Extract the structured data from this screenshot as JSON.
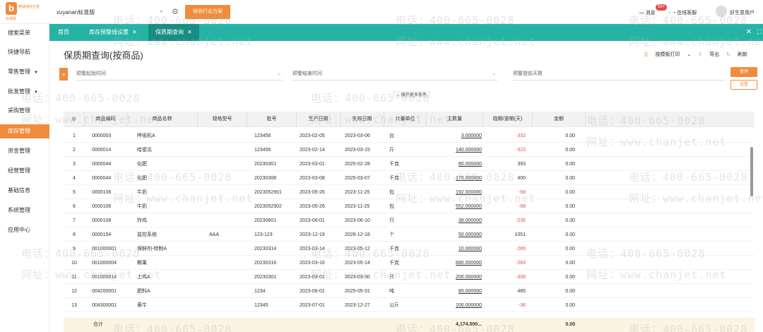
{
  "topbar": {
    "logo_char": "b",
    "logo_text": "畅捷通好生意",
    "logo_sub": "标准版",
    "company": "xuyanan标准版",
    "trial_button": "体验行业方案",
    "message_label": "消息",
    "message_badge": "99+",
    "online_label": "在线客服",
    "user_label": "好生意用户"
  },
  "sidebar": {
    "items": [
      {
        "label": "搜索菜单"
      },
      {
        "label": "快捷导航"
      },
      {
        "label": "零售管理"
      },
      {
        "label": "批发管理"
      },
      {
        "label": "采购管理"
      },
      {
        "label": "库存管理"
      },
      {
        "label": "资金管理"
      },
      {
        "label": "经营管理"
      },
      {
        "label": "基础信息"
      },
      {
        "label": "系统管理"
      },
      {
        "label": "应用中心"
      }
    ]
  },
  "tabs": {
    "home": "首页",
    "t1": "库存预警线设置",
    "t2": "保质期查询"
  },
  "page": {
    "title": "保质期查询(按商品)",
    "print": "按模板打印",
    "export": "导出",
    "refresh": "刷新",
    "f1": "预警起始时间",
    "f2": "预警结束时间",
    "f3": "预警提前天数",
    "query": "查询",
    "settings": "设置",
    "more": "展开更多条件"
  },
  "grid": {
    "headers": [
      "◎",
      "商品编码",
      "商品名称",
      "规格型号",
      "批号",
      "生产日期",
      "失效日期",
      "计量单位",
      "主数量",
      "临期/逾期(天)",
      "金额"
    ],
    "rows": [
      {
        "no": "1",
        "code": "0000003",
        "name": "呼吸机A",
        "spec": "",
        "batch": "123456",
        "prod": "2023-02-05",
        "exp": "2023-03-06",
        "unit": "台",
        "qty": "3.000000",
        "days": "-332",
        "amt": "0.00"
      },
      {
        "no": "2",
        "code": "0000014",
        "name": "哈密瓜",
        "spec": "",
        "batch": "123456",
        "prod": "2023-02-14",
        "exp": "2023-03-15",
        "unit": "斤",
        "qty": "140.000000",
        "days": "-323",
        "amt": "0.00"
      },
      {
        "no": "3",
        "code": "0000044",
        "name": "化肥",
        "spec": "",
        "batch": "20230301",
        "prod": "2023-03-01",
        "exp": "2025-02-28",
        "unit": "千克",
        "qty": "80.000000",
        "days": "393",
        "amt": "0.00"
      },
      {
        "no": "4",
        "code": "0000044",
        "name": "化肥",
        "spec": "",
        "batch": "20230308",
        "prod": "2023-03-08",
        "exp": "2025-03-07",
        "unit": "千克",
        "qty": "170.000000",
        "days": "400",
        "amt": "0.00"
      },
      {
        "no": "5",
        "code": "0000106",
        "name": "牛奶",
        "spec": "",
        "batch": "2023052901",
        "prod": "2023-05-26",
        "exp": "2023-11-25",
        "unit": "包",
        "qty": "192.000000",
        "days": "-68",
        "amt": "0.00"
      },
      {
        "no": "6",
        "code": "0000106",
        "name": "牛奶",
        "spec": "",
        "batch": "2023052902",
        "prod": "2023-05-26",
        "exp": "2023-11-25",
        "unit": "包",
        "qty": "552.000000",
        "days": "-68",
        "amt": "0.00"
      },
      {
        "no": "7",
        "code": "0000108",
        "name": "炸鸡",
        "spec": "",
        "batch": "20230601",
        "prod": "2023-06-01",
        "exp": "2023-06-10",
        "unit": "只",
        "qty": "38.000000",
        "days": "-236",
        "amt": "0.00"
      },
      {
        "no": "8",
        "code": "0000154",
        "name": "监控系统",
        "spec": "AAA",
        "batch": "123-123",
        "prod": "2023-12-19",
        "exp": "2026-12-18",
        "unit": "个",
        "qty": "50.000000",
        "days": "1051",
        "amt": "0.00"
      },
      {
        "no": "9",
        "code": "001000001",
        "name": "保鲜剂-特制A",
        "spec": "",
        "batch": "20230314",
        "prod": "2023-03-14",
        "exp": "2023-05-12",
        "unit": "千克",
        "qty": "10.000000",
        "days": "-285",
        "amt": "0.00"
      },
      {
        "no": "10",
        "code": "001000004",
        "name": "椰果",
        "spec": "",
        "batch": "20230316",
        "prod": "2023-03-16",
        "exp": "2023-05-14",
        "unit": "千克",
        "qty": "680.000000",
        "days": "-283",
        "amt": "0.00"
      },
      {
        "no": "11",
        "code": "001000014",
        "name": "土鸡A",
        "spec": "",
        "batch": "20230301",
        "prod": "2023-03-01",
        "exp": "2023-03-30",
        "unit": "只",
        "qty": "200.000000",
        "days": "-308",
        "amt": "0.00"
      },
      {
        "no": "12",
        "code": "004200001",
        "name": "肥料A",
        "spec": "",
        "batch": "1234",
        "prod": "2023-06-01",
        "exp": "2025-05-31",
        "unit": "吨",
        "qty": "85.000000",
        "days": "485",
        "amt": "0.00"
      },
      {
        "no": "13",
        "code": "004300001",
        "name": "黄牛",
        "spec": "",
        "batch": "12345",
        "prod": "2023-07-01",
        "exp": "2023-12-27",
        "unit": "公斤",
        "qty": "100.000000",
        "days": "-36",
        "amt": "0.00"
      }
    ],
    "total_label": "合计",
    "total_qty": "4,174.000...",
    "total_amt": "0.00"
  },
  "watermark": {
    "phone": "电话：400-665-0028",
    "site": "网址：www.chanjet.net"
  },
  "colors": {
    "accent": "#f08c3c",
    "teal": "#26b3a6",
    "negative": "#d9534f"
  }
}
